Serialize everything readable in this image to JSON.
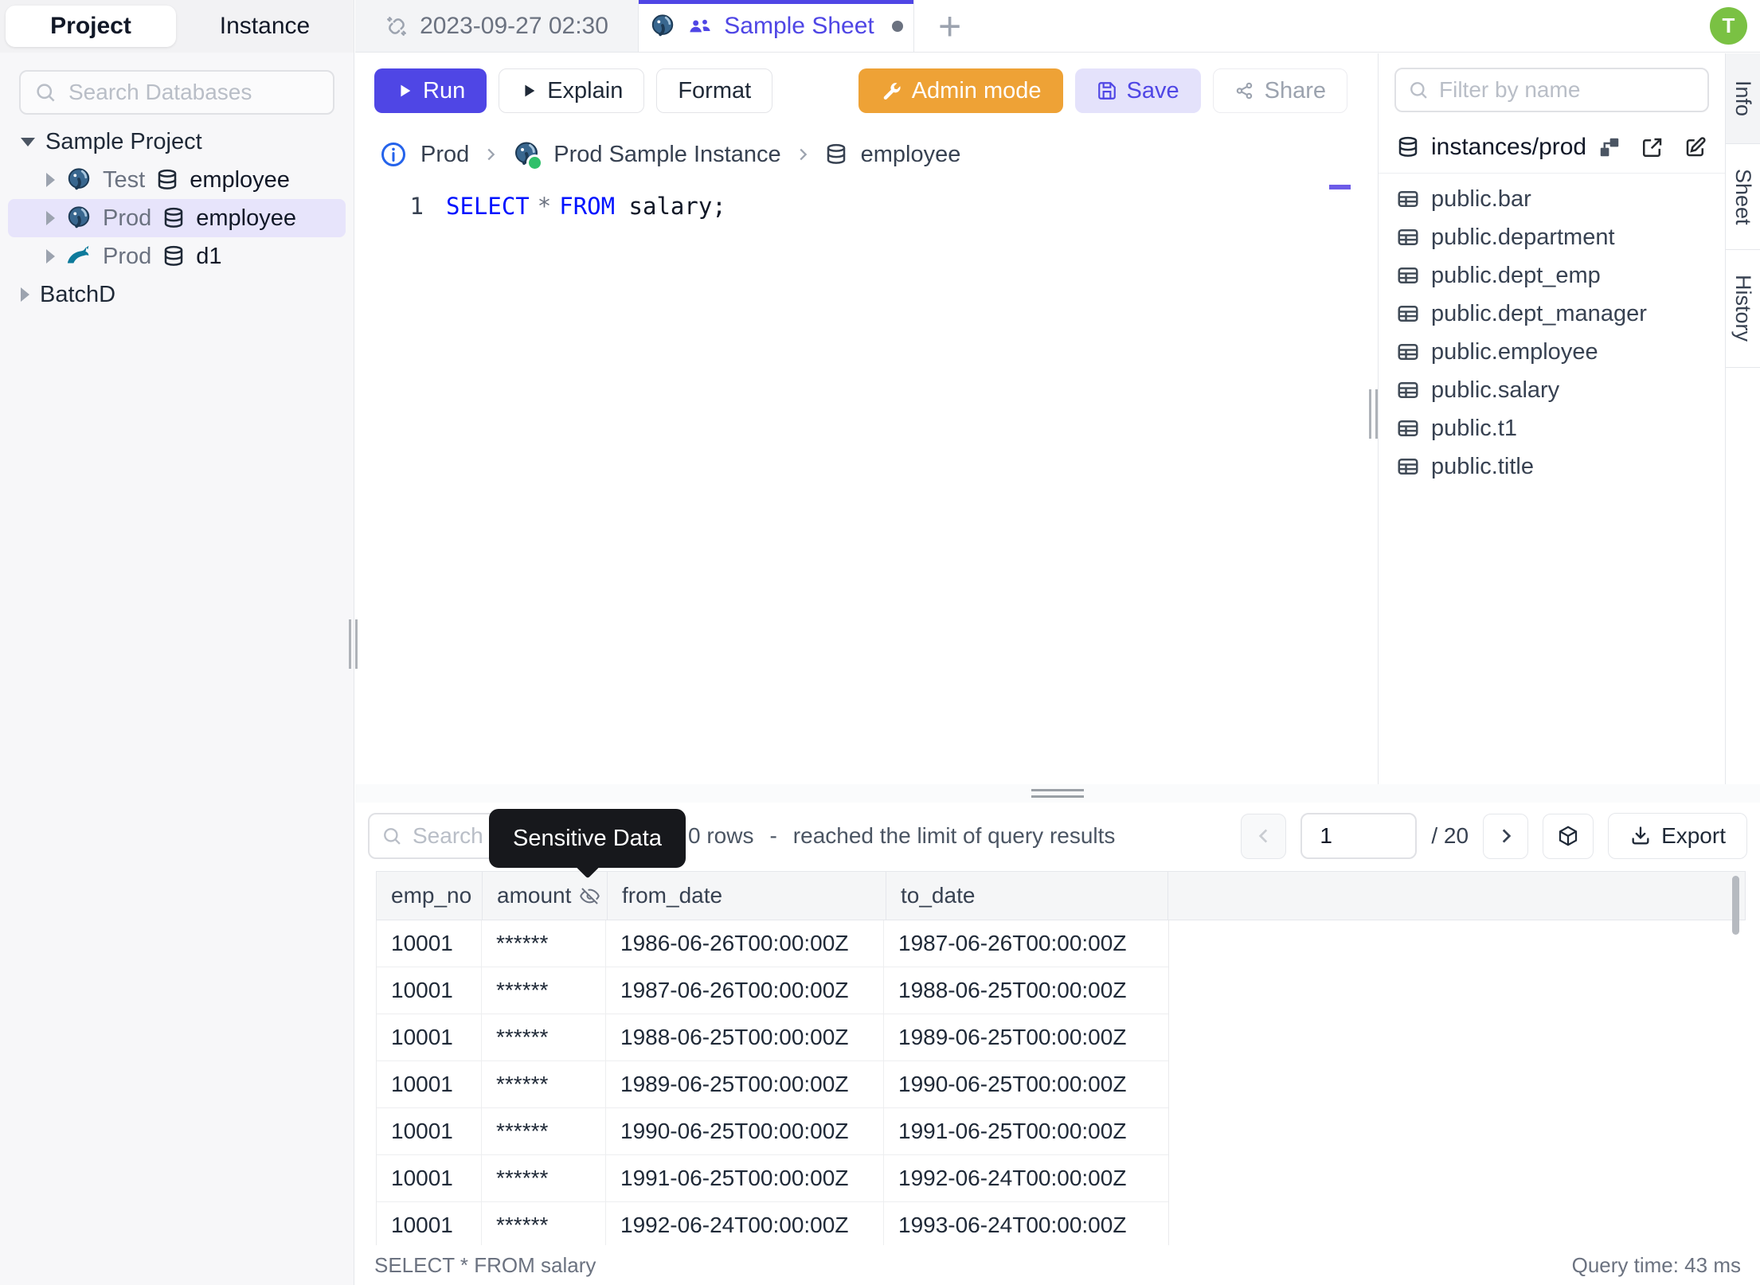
{
  "colors": {
    "accent_indigo": "#4f46e5",
    "admin_orange": "#eea236",
    "avatar_green": "#7ac143",
    "selected_row_lavender": "#e7e4fb",
    "tooltip_black": "#17181c",
    "sql_keyword_blue": "#0013ff"
  },
  "sidebar": {
    "tabs": [
      {
        "label": "Project"
      },
      {
        "label": "Instance"
      }
    ],
    "search_placeholder": "Search Databases",
    "tree": [
      {
        "label": "Sample Project"
      },
      {
        "env": "Test",
        "db": "employee",
        "engine": "postgres"
      },
      {
        "env": "Prod",
        "db": "employee",
        "engine": "postgres",
        "selected": true
      },
      {
        "env": "Prod",
        "db": "d1",
        "engine": "mysql"
      },
      {
        "label": "BatchD"
      }
    ]
  },
  "tabbar": {
    "tabs": [
      {
        "label": "2023-09-27 02:30"
      },
      {
        "label": "Sample Sheet"
      }
    ],
    "new_tab": "+",
    "avatar": "T"
  },
  "toolbar": {
    "run": "Run",
    "explain": "Explain",
    "format": "Format",
    "admin_mode": "Admin mode",
    "save": "Save",
    "share": "Share"
  },
  "breadcrumb": {
    "env": "Prod",
    "instance": "Prod Sample Instance",
    "database": "employee"
  },
  "editor": {
    "line_number": "1",
    "tokens": {
      "select": "SELECT",
      "star": "*",
      "from": "FROM",
      "rest": "salary;"
    }
  },
  "right_panel": {
    "filter_placeholder": "Filter by name",
    "scope": "instances/prod",
    "tables": [
      "public.bar",
      "public.department",
      "public.dept_emp",
      "public.dept_manager",
      "public.employee",
      "public.salary",
      "public.t1",
      "public.title"
    ],
    "side_tabs": [
      "Info",
      "Sheet",
      "History"
    ]
  },
  "results": {
    "search_placeholder": "Search",
    "tooltip": "Sensitive Data",
    "rows_count": "0 rows",
    "dash": "-",
    "limit_text": "reached the limit of query results",
    "page_value": "1",
    "page_total": "/ 20",
    "export_label": "Export",
    "columns": [
      "emp_no",
      "amount",
      "from_date",
      "to_date"
    ],
    "rows": [
      {
        "emp_no": "10001",
        "amount": "******",
        "from_date": "1986-06-26T00:00:00Z",
        "to_date": "1987-06-26T00:00:00Z"
      },
      {
        "emp_no": "10001",
        "amount": "******",
        "from_date": "1987-06-26T00:00:00Z",
        "to_date": "1988-06-25T00:00:00Z"
      },
      {
        "emp_no": "10001",
        "amount": "******",
        "from_date": "1988-06-25T00:00:00Z",
        "to_date": "1989-06-25T00:00:00Z"
      },
      {
        "emp_no": "10001",
        "amount": "******",
        "from_date": "1989-06-25T00:00:00Z",
        "to_date": "1990-06-25T00:00:00Z"
      },
      {
        "emp_no": "10001",
        "amount": "******",
        "from_date": "1990-06-25T00:00:00Z",
        "to_date": "1991-06-25T00:00:00Z"
      },
      {
        "emp_no": "10001",
        "amount": "******",
        "from_date": "1991-06-25T00:00:00Z",
        "to_date": "1992-06-24T00:00:00Z"
      },
      {
        "emp_no": "10001",
        "amount": "******",
        "from_date": "1992-06-24T00:00:00Z",
        "to_date": "1993-06-24T00:00:00Z"
      }
    ],
    "status_query": "SELECT * FROM salary",
    "status_time": "Query time: 43 ms"
  }
}
